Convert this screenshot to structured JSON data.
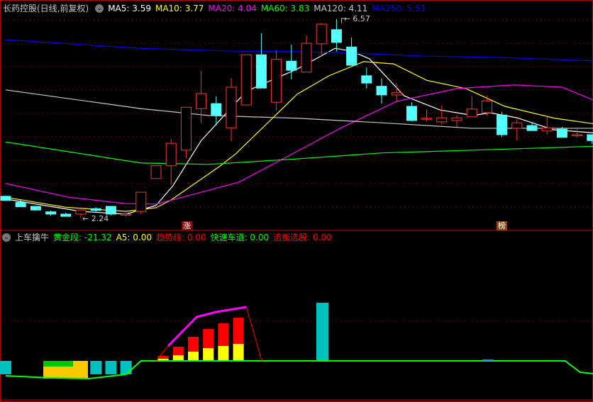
{
  "header": {
    "title": "长药控股(日线,前复权)",
    "ma": [
      {
        "label": "MA5: 3.59",
        "color": "#ffffff"
      },
      {
        "label": "MA10: 3.77",
        "color": "#ffff00"
      },
      {
        "label": "MA20: 4.04",
        "color": "#ff00ff"
      },
      {
        "label": "MA60: 3.83",
        "color": "#00ff00"
      },
      {
        "label": "MA120: 4.11",
        "color": "#c8c8c8"
      },
      {
        "label": "MA250: 5.51",
        "color": "#0000ff"
      }
    ]
  },
  "indicator": {
    "title": "上车擒牛",
    "items": [
      {
        "label": "黄金段: -21.32",
        "color": "#00ff00"
      },
      {
        "label": "A5: 0.00",
        "color": "#ffff00"
      },
      {
        "label": "趋势线: 0.00",
        "color": "#ff0000"
      },
      {
        "label": "快速车道: 0.00",
        "color": "#00ff00"
      },
      {
        "label": "追板选股: 0.00",
        "color": "#ff0000"
      }
    ]
  },
  "annotations": {
    "high_label": "6.57",
    "low_label": "2.24",
    "marker1": "涨",
    "marker2": "榜"
  },
  "colors": {
    "up": "#ff3232",
    "down": "#54ffff",
    "grid": "#8b0000"
  },
  "chart_data": {
    "type": "candlestick",
    "price_range": [
      2.24,
      6.57
    ],
    "candles": [
      [
        2.69,
        2.6,
        2.71,
        2.59
      ],
      [
        2.56,
        2.46,
        2.61,
        2.46
      ],
      [
        2.47,
        2.39,
        2.48,
        2.38
      ],
      [
        2.35,
        2.3,
        2.38,
        2.26
      ],
      [
        2.3,
        2.25,
        2.33,
        2.25
      ],
      [
        2.3,
        2.39,
        2.39,
        2.24
      ],
      [
        2.42,
        2.38,
        2.45,
        2.33
      ],
      [
        2.47,
        2.3,
        2.47,
        2.27
      ],
      [
        2.3,
        2.3,
        2.33,
        2.25
      ],
      [
        2.36,
        2.78,
        2.78,
        2.3
      ],
      [
        3.08,
        3.36,
        3.36,
        3.08
      ],
      [
        3.36,
        3.85,
        3.95,
        2.94
      ],
      [
        3.7,
        4.64,
        4.64,
        3.53
      ],
      [
        4.61,
        4.94,
        5.44,
        4.29
      ],
      [
        4.72,
        4.46,
        4.88,
        4.24
      ],
      [
        4.19,
        5.08,
        5.28,
        3.9
      ],
      [
        4.69,
        5.79,
        5.79,
        4.69
      ],
      [
        5.79,
        5.06,
        6.26,
        5.06
      ],
      [
        4.75,
        5.69,
        5.89,
        4.57
      ],
      [
        5.65,
        5.45,
        6.01,
        5.25
      ],
      [
        5.41,
        6.04,
        6.21,
        5.41
      ],
      [
        6.03,
        6.46,
        6.49,
        5.75
      ],
      [
        6.34,
        6.06,
        6.57,
        5.86
      ],
      [
        5.96,
        5.56,
        6.17,
        5.56
      ],
      [
        5.33,
        5.17,
        5.51,
        5.05
      ],
      [
        5.1,
        4.91,
        5.27,
        4.72
      ],
      [
        4.91,
        4.96,
        5.16,
        4.77
      ],
      [
        4.66,
        4.35,
        4.75,
        4.33
      ],
      [
        4.4,
        4.4,
        4.6,
        4.32
      ],
      [
        4.32,
        4.41,
        4.68,
        4.26
      ],
      [
        4.35,
        4.41,
        4.47,
        4.21
      ],
      [
        4.43,
        4.6,
        4.89,
        4.43
      ],
      [
        4.52,
        4.78,
        4.89,
        4.46
      ],
      [
        4.47,
        4.04,
        4.54,
        3.99
      ],
      [
        4.18,
        4.3,
        4.38,
        3.91
      ],
      [
        4.24,
        4.13,
        4.3,
        4.13
      ],
      [
        4.12,
        4.19,
        4.43,
        4.04
      ],
      [
        4.16,
        3.98,
        4.21,
        3.98
      ],
      [
        4.04,
        4.04,
        4.16,
        3.98
      ],
      [
        4.04,
        3.91,
        4.04,
        3.84
      ]
    ],
    "ma_lines": [
      {
        "name": "MA5",
        "color": "#ffffff",
        "points": [
          [
            0,
            2.63
          ],
          [
            5,
            2.36
          ],
          [
            8,
            2.3
          ],
          [
            10,
            2.49
          ],
          [
            11.1,
            2.91
          ],
          [
            13,
            3.91
          ],
          [
            16,
            4.99
          ],
          [
            19.4,
            5.48
          ],
          [
            21.9,
            5.93
          ],
          [
            23,
            5.87
          ],
          [
            24.2,
            5.7
          ],
          [
            26.5,
            4.89
          ],
          [
            28.9,
            4.58
          ],
          [
            31.1,
            4.46
          ],
          [
            32.2,
            4.52
          ],
          [
            34,
            4.41
          ],
          [
            36.4,
            4.15
          ],
          [
            39.5,
            4.07
          ]
        ]
      },
      {
        "name": "MA10",
        "color": "#ffff00",
        "points": [
          [
            0,
            2.67
          ],
          [
            4,
            2.45
          ],
          [
            8,
            2.36
          ],
          [
            10,
            2.44
          ],
          [
            11,
            2.61
          ],
          [
            14.2,
            3.34
          ],
          [
            15.3,
            3.62
          ],
          [
            19.4,
            4.93
          ],
          [
            21.5,
            5.33
          ],
          [
            23.8,
            5.64
          ],
          [
            25.8,
            5.59
          ],
          [
            28,
            5.23
          ],
          [
            30.6,
            5.05
          ],
          [
            33.2,
            4.66
          ],
          [
            36.5,
            4.4
          ],
          [
            39.5,
            4.26
          ]
        ]
      },
      {
        "name": "MA20",
        "color": "#ff00ff",
        "points": [
          [
            0,
            2.97
          ],
          [
            4.2,
            2.67
          ],
          [
            8,
            2.53
          ],
          [
            10,
            2.52
          ],
          [
            11.4,
            2.64
          ],
          [
            15.5,
            3.0
          ],
          [
            19.4,
            3.68
          ],
          [
            22.3,
            4.19
          ],
          [
            26,
            4.77
          ],
          [
            30,
            5.05
          ],
          [
            33.8,
            5.13
          ],
          [
            37,
            5.08
          ],
          [
            39.5,
            4.74
          ]
        ]
      },
      {
        "name": "MA60",
        "color": "#00ff00",
        "points": [
          [
            0,
            3.88
          ],
          [
            9,
            3.42
          ],
          [
            13.5,
            3.39
          ],
          [
            19.4,
            3.51
          ],
          [
            25,
            3.64
          ],
          [
            31,
            3.7
          ],
          [
            39.5,
            3.79
          ]
        ]
      },
      {
        "name": "MA120",
        "color": "#c8c8c8",
        "points": [
          [
            0,
            5.02
          ],
          [
            9,
            4.61
          ],
          [
            13.5,
            4.46
          ],
          [
            19.4,
            4.4
          ],
          [
            25,
            4.3
          ],
          [
            31,
            4.18
          ],
          [
            39.5,
            4.18
          ]
        ]
      },
      {
        "name": "MA250",
        "color": "#0000ff",
        "points": [
          [
            0,
            6.12
          ],
          [
            9,
            5.93
          ],
          [
            15,
            5.87
          ],
          [
            19.4,
            5.86
          ],
          [
            22,
            5.84
          ],
          [
            28,
            5.76
          ],
          [
            33,
            5.73
          ],
          [
            39.5,
            5.65
          ]
        ]
      }
    ],
    "indicator_bars": {
      "red_total": [
        [
          10.5,
          7
        ],
        [
          11.5,
          20
        ],
        [
          12.5,
          34
        ],
        [
          13.5,
          45
        ],
        [
          14.5,
          53
        ],
        [
          15.5,
          61
        ]
      ],
      "yellow": [
        [
          10.5,
          3
        ],
        [
          11.5,
          8
        ],
        [
          12.5,
          13
        ],
        [
          13.5,
          18
        ],
        [
          14.5,
          21
        ],
        [
          15.5,
          24
        ]
      ],
      "cyan_neg": [
        [
          0,
          -19
        ],
        [
          5,
          -19
        ],
        [
          6,
          -19
        ],
        [
          7,
          -19
        ],
        [
          8,
          -19
        ]
      ],
      "cyan_pos": [
        [
          21,
          82
        ]
      ],
      "trend_line": [
        [
          10.8,
          21
        ],
        [
          12.7,
          62
        ],
        [
          14,
          69
        ],
        [
          16,
          76
        ]
      ],
      "green_line": [
        [
          0,
          -21
        ],
        [
          3,
          -24
        ],
        [
          5.5,
          -25
        ],
        [
          8,
          -19
        ],
        [
          9,
          0
        ],
        [
          37.2,
          0
        ],
        [
          38.2,
          -16
        ],
        [
          39.5,
          -19
        ]
      ]
    }
  }
}
